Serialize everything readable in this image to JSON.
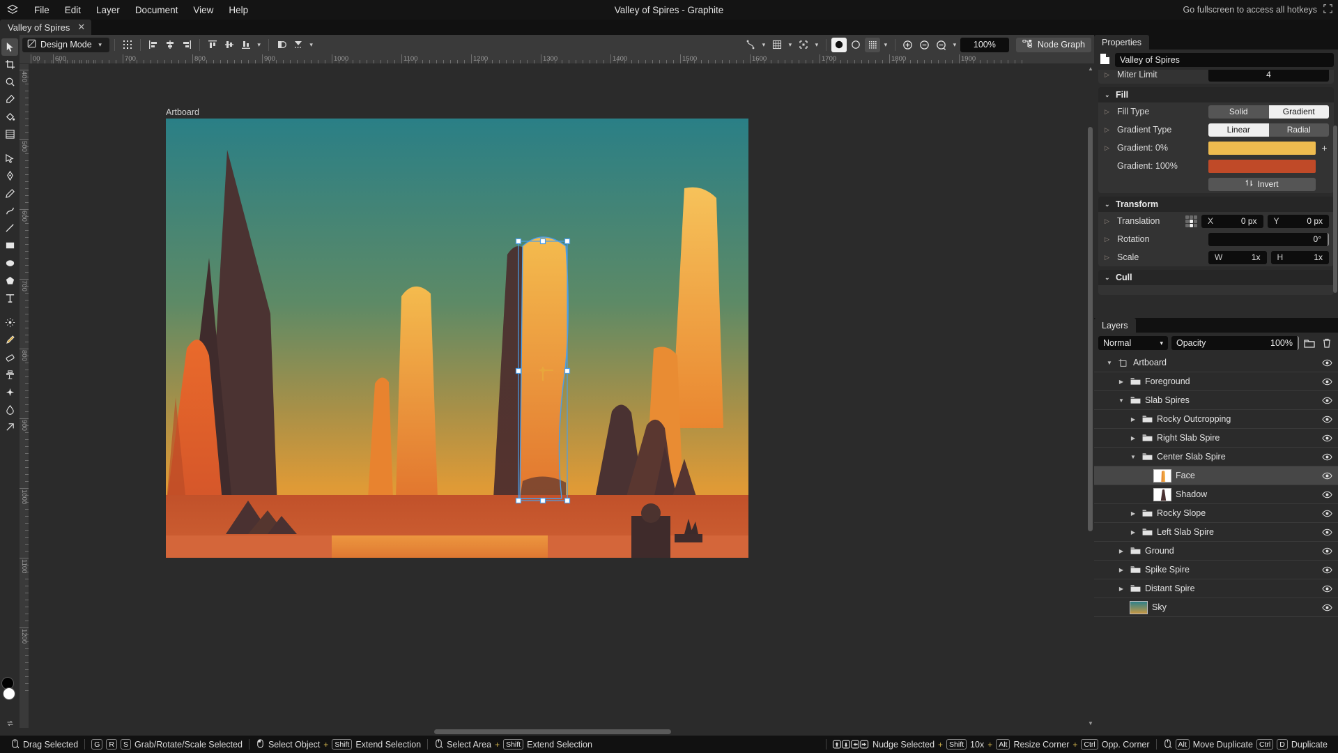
{
  "app": {
    "title": "Valley of Spires - Graphite",
    "logo_icon": "graphite-logo-icon",
    "fullscreen_hint": "Go fullscreen to access all hotkeys"
  },
  "menubar": {
    "items": [
      "File",
      "Edit",
      "Layer",
      "Document",
      "View",
      "Help"
    ]
  },
  "document_tabs": [
    {
      "label": "Valley of Spires",
      "close_icon": "close-icon",
      "active": true
    }
  ],
  "tools": [
    {
      "name": "select-tool",
      "icon": "cursor-arrow"
    },
    {
      "name": "artboard-tool",
      "icon": "crop-frame"
    },
    {
      "name": "navigate-tool",
      "icon": "magnifier-hand"
    },
    {
      "name": "eyedropper-tool",
      "icon": "eyedropper"
    },
    {
      "name": "fill-tool",
      "icon": "paint-bucket"
    },
    {
      "name": "gradient-tool",
      "icon": "gradient-grid"
    },
    {
      "name": "path-tool",
      "icon": "path-node"
    },
    {
      "name": "pen-tool",
      "icon": "pen-nib"
    },
    {
      "name": "freehand-tool",
      "icon": "pencil"
    },
    {
      "name": "spline-tool",
      "icon": "spline-curve"
    },
    {
      "name": "line-tool",
      "icon": "line"
    },
    {
      "name": "rectangle-tool",
      "icon": "rectangle"
    },
    {
      "name": "ellipse-tool",
      "icon": "ellipse"
    },
    {
      "name": "polygon-tool",
      "icon": "polygon"
    },
    {
      "name": "text-tool",
      "icon": "text-T"
    },
    {
      "name": "brush-tool",
      "icon": "brush-dot"
    },
    {
      "name": "paintbrush-tool",
      "icon": "paintbrush"
    },
    {
      "name": "eraser-tool",
      "icon": "eraser"
    },
    {
      "name": "clone-tool",
      "icon": "clone-stamp"
    },
    {
      "name": "detail-tool",
      "icon": "sparkle"
    },
    {
      "name": "blur-tool",
      "icon": "droplet"
    },
    {
      "name": "relight-tool",
      "icon": "relight"
    }
  ],
  "options_bar": {
    "mode_label": "Design Mode",
    "mode_icon": "design-mode-icon",
    "mode_caret": "chevron-down-icon",
    "transform_icon": "transform-pivot-icon",
    "align_left_icon": "align-left-icon",
    "align_hcenter_icon": "align-horizontal-center-icon",
    "align_right_icon": "align-right-icon",
    "align_top_icon": "align-top-icon",
    "align_vcenter_icon": "align-vertical-center-icon",
    "align_bottom_icon": "align-bottom-icon",
    "align_caret": "chevron-down-icon",
    "boolean_icon": "boolean-ops-icon",
    "flatten_icon": "flatten-icon",
    "flatten_caret": "chevron-down-icon",
    "snapping_icon": "snapping-icon",
    "snapping_caret": "chevron-down-icon",
    "grid_icon": "grid-icon",
    "grid_caret": "chevron-down-icon",
    "overlays_icon": "overlays-icon",
    "overlays_caret": "chevron-down-icon",
    "view_solid_icon": "view-mode-normal-icon",
    "view_outline_icon": "view-mode-outline-icon",
    "view_pixels_icon": "view-mode-pixels-icon",
    "view_caret": "chevron-down-icon",
    "zoom_in_icon": "zoom-in-icon",
    "zoom_out_icon": "zoom-out-icon",
    "zoom_reset_icon": "zoom-reset-icon",
    "zoom_caret": "chevron-down-icon",
    "zoom_value": "100%",
    "node_graph_label": "Node Graph",
    "node_graph_icon": "node-graph-icon"
  },
  "canvas": {
    "artboard_label": "Artboard",
    "h_ruler_labels": [
      "00",
      "600",
      "700",
      "800",
      "900",
      "1000",
      "1100",
      "1200",
      "1300",
      "1400",
      "1500",
      "1600",
      "1700",
      "1800",
      "1900"
    ],
    "v_ruler_labels": [
      "400",
      "500",
      "600",
      "700",
      "800",
      "900",
      "1000",
      "1100",
      "1200"
    ]
  },
  "properties": {
    "tab_label": "Properties",
    "doc_icon": "document-icon",
    "doc_name": "Valley of Spires",
    "rows_top": [
      {
        "label": "Miter Limit",
        "value": "4",
        "triangle": "collapsed-triangle-icon"
      }
    ],
    "fill": {
      "title": "Fill",
      "chevron": "chevron-down-icon",
      "fill_type": {
        "label": "Fill Type",
        "options": [
          "Solid",
          "Gradient"
        ],
        "selected": "Gradient"
      },
      "gradient_type": {
        "label": "Gradient Type",
        "options": [
          "Linear",
          "Radial"
        ],
        "selected": "Linear"
      },
      "gradient_0": {
        "label": "Gradient: 0%",
        "color": "#eebb4f",
        "add_icon": "plus-icon"
      },
      "gradient_100": {
        "label": "Gradient: 100%",
        "color": "#c04a28"
      },
      "invert": {
        "label": "Invert",
        "icon": "invert-arrows-icon"
      }
    },
    "transform": {
      "title": "Transform",
      "chevron": "chevron-down-icon",
      "translation": {
        "label": "Translation",
        "anchor_icon": "anchor-grid-icon",
        "x_key": "X",
        "x_value": "0 px",
        "y_key": "Y",
        "y_value": "0 px"
      },
      "rotation": {
        "label": "Rotation",
        "value": "0°"
      },
      "scale": {
        "label": "Scale",
        "w_key": "W",
        "w_value": "1x",
        "h_key": "H",
        "h_value": "1x"
      }
    },
    "cull": {
      "title": "Cull",
      "chevron": "chevron-down-icon"
    }
  },
  "layers": {
    "tab_label": "Layers",
    "blend_mode": "Normal",
    "blend_caret": "chevron-down-icon",
    "opacity_label": "Opacity",
    "opacity_value": "100%",
    "new_folder_icon": "new-folder-icon",
    "delete_icon": "trash-icon",
    "items": [
      {
        "name": "Artboard",
        "depth": 0,
        "arrow": "expanded",
        "icon": "artboard-icon",
        "eye": "eye-icon",
        "selected": false
      },
      {
        "name": "Foreground",
        "depth": 1,
        "arrow": "collapsed",
        "icon": "folder-icon",
        "eye": "eye-icon",
        "selected": false
      },
      {
        "name": "Slab Spires",
        "depth": 1,
        "arrow": "expanded",
        "icon": "folder-icon",
        "eye": "eye-icon",
        "selected": false
      },
      {
        "name": "Rocky Outcropping",
        "depth": 2,
        "arrow": "collapsed",
        "icon": "folder-icon",
        "eye": "eye-icon",
        "selected": false
      },
      {
        "name": "Right Slab Spire",
        "depth": 2,
        "arrow": "collapsed",
        "icon": "folder-icon",
        "eye": "eye-icon",
        "selected": false
      },
      {
        "name": "Center Slab Spire",
        "depth": 2,
        "arrow": "expanded",
        "icon": "folder-icon",
        "eye": "eye-icon",
        "selected": false
      },
      {
        "name": "Face",
        "depth": 3,
        "arrow": "none",
        "icon": "thumbnail-face",
        "eye": "eye-icon",
        "selected": true
      },
      {
        "name": "Shadow",
        "depth": 3,
        "arrow": "none",
        "icon": "thumbnail-shadow",
        "eye": "eye-icon",
        "selected": false
      },
      {
        "name": "Rocky Slope",
        "depth": 2,
        "arrow": "collapsed",
        "icon": "folder-icon",
        "eye": "eye-icon",
        "selected": false
      },
      {
        "name": "Left Slab Spire",
        "depth": 2,
        "arrow": "collapsed",
        "icon": "folder-icon",
        "eye": "eye-icon",
        "selected": false
      },
      {
        "name": "Ground",
        "depth": 1,
        "arrow": "collapsed",
        "icon": "folder-icon",
        "eye": "eye-icon",
        "selected": false
      },
      {
        "name": "Spike Spire",
        "depth": 1,
        "arrow": "collapsed",
        "icon": "folder-icon",
        "eye": "eye-icon",
        "selected": false
      },
      {
        "name": "Distant Spire",
        "depth": 1,
        "arrow": "collapsed",
        "icon": "folder-icon",
        "eye": "eye-icon",
        "selected": false
      },
      {
        "name": "Sky",
        "depth": 1,
        "arrow": "none",
        "icon": "thumbnail-sky",
        "eye": "eye-icon",
        "selected": false
      }
    ]
  },
  "status_bar": [
    {
      "icon": "mouse-drag-icon",
      "keys": [],
      "label": "Drag Selected"
    },
    {
      "icon": "",
      "keys": [
        "G",
        "R",
        "S"
      ],
      "label": "Grab/Rotate/Scale Selected"
    },
    {
      "icon": "mouse-left-icon",
      "keys": [],
      "label": "Select Object",
      "plus": true,
      "keys2": [
        "Shift"
      ],
      "label2": "Extend Selection"
    },
    {
      "icon": "mouse-drag-icon",
      "keys": [],
      "label": "Select Area",
      "plus": true,
      "keys2": [
        "Shift"
      ],
      "label2": "Extend Selection"
    },
    {
      "icon": "arrow-keys-icon",
      "keys": [],
      "label": "Nudge Selected",
      "plus": true,
      "keys2": [
        "Shift"
      ],
      "label2": "10x",
      "plus2": true,
      "keys3": [
        "Alt"
      ],
      "label3": "Resize Corner",
      "plus3": true,
      "keys4": [
        "Ctrl"
      ],
      "label4": "Opp. Corner"
    },
    {
      "icon": "mouse-drag-icon",
      "keys": [
        "Alt"
      ],
      "label": "Move Duplicate",
      "keys2": [
        "Ctrl",
        "D"
      ],
      "label2": "Duplicate"
    }
  ],
  "colors": {
    "accent": "#d2b44c",
    "panel_bg": "#2b2b2b",
    "dark_bg": "#111111",
    "field_bg": "#0d0d0d",
    "selection_blue": "#4a9eea",
    "sky_top": "#2a7f86",
    "sky_mid": "#7e8f56",
    "sky_bottom": "#e8a13a",
    "ground": "#c1562c",
    "spire_light": "#f2b04a",
    "spire_dark": "#3e2b2b"
  }
}
